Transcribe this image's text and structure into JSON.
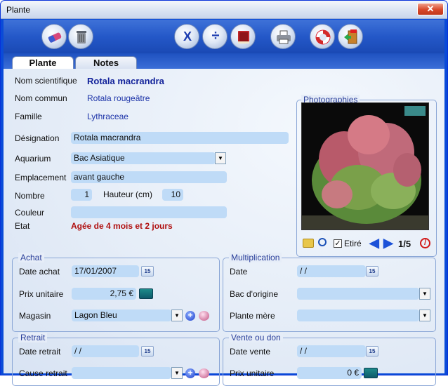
{
  "window": {
    "title": "Plante",
    "close_glyph": "✕"
  },
  "toolbar": {
    "buttons": [
      {
        "name": "eraser-icon"
      },
      {
        "name": "trash-icon"
      },
      {
        "name": "multiply-icon",
        "glyph": "X"
      },
      {
        "name": "divide-icon",
        "glyph": "÷"
      },
      {
        "name": "book-icon"
      },
      {
        "name": "printer-icon"
      },
      {
        "name": "lifebuoy-icon"
      },
      {
        "name": "exit-door-icon"
      }
    ]
  },
  "tabs": [
    {
      "label": "Plante"
    },
    {
      "label": "Notes"
    }
  ],
  "plant": {
    "nom_scientifique_label": "Nom scientifique",
    "nom_scientifique": "Rotala macrandra",
    "nom_commun_label": "Nom commun",
    "nom_commun": "Rotala rougeâtre",
    "famille_label": "Famille",
    "famille": "Lythraceae",
    "designation_label": "Désignation",
    "designation": "Rotala macrandra",
    "aquarium_label": "Aquarium",
    "aquarium": "Bac Asiatique",
    "emplacement_label": "Emplacement",
    "emplacement": "avant gauche",
    "nombre_label": "Nombre",
    "nombre": "1",
    "hauteur_label": "Hauteur (cm)",
    "hauteur": "10",
    "couleur_label": "Couleur",
    "couleur": "",
    "etat_label": "Etat",
    "etat": "Agée de 4 mois et 2 jours"
  },
  "photos": {
    "title": "Photographies",
    "etire_label": "Etiré",
    "etire_checked": true,
    "counter": "1/5"
  },
  "achat": {
    "title": "Achat",
    "date_label": "Date achat",
    "date": "17/01/2007",
    "prix_label": "Prix unitaire",
    "prix": "2,75 €",
    "magasin_label": "Magasin",
    "magasin": "Lagon Bleu"
  },
  "multiplication": {
    "title": "Multiplication",
    "date_label": "Date",
    "date": "/ /",
    "bac_label": "Bac d'origine",
    "bac": "",
    "plante_label": "Plante mère",
    "plante": ""
  },
  "retrait": {
    "title": "Retrait",
    "date_label": "Date retrait",
    "date": "/ /",
    "cause_label": "Cause retrait",
    "cause": ""
  },
  "vente": {
    "title": "Vente ou don",
    "date_label": "Date vente",
    "date": "/ /",
    "prix_label": "Prix unitaire",
    "prix": "0 €"
  },
  "calendar_glyph": "15",
  "colors": {
    "title_bar": "#dfe7f4",
    "toolbar": "#2458c8",
    "field": "#bfdbf7",
    "etat_red": "#b01010",
    "value_blue": "#1c33a8"
  }
}
